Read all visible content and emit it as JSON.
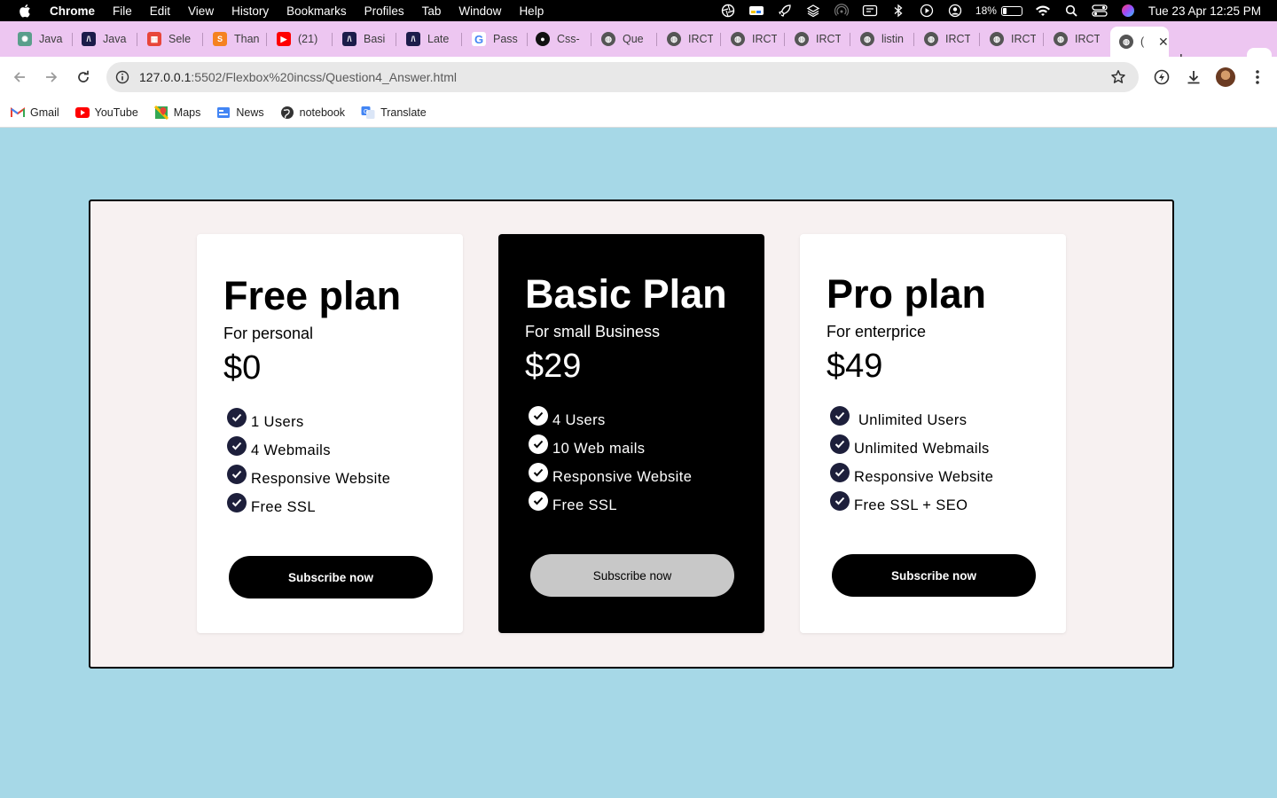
{
  "menubar": {
    "app_name": "Chrome",
    "items": [
      "File",
      "Edit",
      "View",
      "History",
      "Bookmarks",
      "Profiles",
      "Tab",
      "Window",
      "Help"
    ],
    "battery": "18%",
    "datetime": "Tue 23 Apr  12:25 PM"
  },
  "tabs": [
    {
      "title": "Java",
      "icon": "chatgpt-icon",
      "color": "#5a9e8b"
    },
    {
      "title": "Java",
      "icon": "code-icon",
      "color": "#1c1c4a"
    },
    {
      "title": "Sele",
      "icon": "grid-icon",
      "color": "#e8463a"
    },
    {
      "title": "Than",
      "icon": "sublime-icon",
      "color": "#f58220"
    },
    {
      "title": "(21)",
      "icon": "youtube-icon",
      "color": "#ff0000"
    },
    {
      "title": "Basi",
      "icon": "code-icon",
      "color": "#1c1c4a"
    },
    {
      "title": "Late",
      "icon": "code-icon",
      "color": "#1c1c4a"
    },
    {
      "title": "Pass",
      "icon": "google-icon",
      "color": "#4285f4"
    },
    {
      "title": "Css-",
      "icon": "github-icon",
      "color": "#111111"
    },
    {
      "title": "Que",
      "icon": "globe-icon",
      "color": "#555555"
    },
    {
      "title": "IRCT",
      "icon": "globe-icon",
      "color": "#555555"
    },
    {
      "title": "IRCT",
      "icon": "globe-icon",
      "color": "#555555"
    },
    {
      "title": "IRCT",
      "icon": "globe-icon",
      "color": "#555555"
    },
    {
      "title": "listin",
      "icon": "globe-icon",
      "color": "#555555"
    },
    {
      "title": "IRCT",
      "icon": "globe-icon",
      "color": "#555555"
    },
    {
      "title": "IRCT",
      "icon": "globe-icon",
      "color": "#555555"
    },
    {
      "title": "IRCT",
      "icon": "globe-icon",
      "color": "#555555"
    }
  ],
  "active_tab": {
    "title": "(",
    "icon": "globe-icon"
  },
  "address_bar": {
    "host": "127.0.0.1",
    "path": ":5502/Flexbox%20incss/Question4_Answer.html"
  },
  "bookmarks": [
    {
      "label": "Gmail",
      "icon": "gmail-icon"
    },
    {
      "label": "YouTube",
      "icon": "youtube-icon"
    },
    {
      "label": "Maps",
      "icon": "maps-icon"
    },
    {
      "label": "News",
      "icon": "news-icon"
    },
    {
      "label": "notebook",
      "icon": "globe-icon"
    },
    {
      "label": "Translate",
      "icon": "translate-icon"
    }
  ],
  "page": {
    "background": "#a6d8e7",
    "dot": ".",
    "plans": [
      {
        "title": "Free plan",
        "subtitle": "For personal",
        "price": "$0",
        "features": [
          "1 Users",
          "4 Webmails",
          "Responsive Website",
          "Free SSL"
        ],
        "button": "Subscribe now",
        "theme": "light"
      },
      {
        "title": "Basic Plan",
        "subtitle": "For small Business",
        "price": "$29",
        "features": [
          "4 Users",
          "10 Web mails",
          "Responsive Website",
          "Free SSL"
        ],
        "button": "Subscribe now",
        "theme": "dark"
      },
      {
        "title": "Pro plan",
        "subtitle": "For enterprice",
        "price": "$49",
        "features": [
          " Unlimited Users",
          "Unlimited Webmails",
          "Responsive Website",
          "Free SSL + SEO"
        ],
        "button": "Subscribe now",
        "theme": "light"
      }
    ]
  }
}
